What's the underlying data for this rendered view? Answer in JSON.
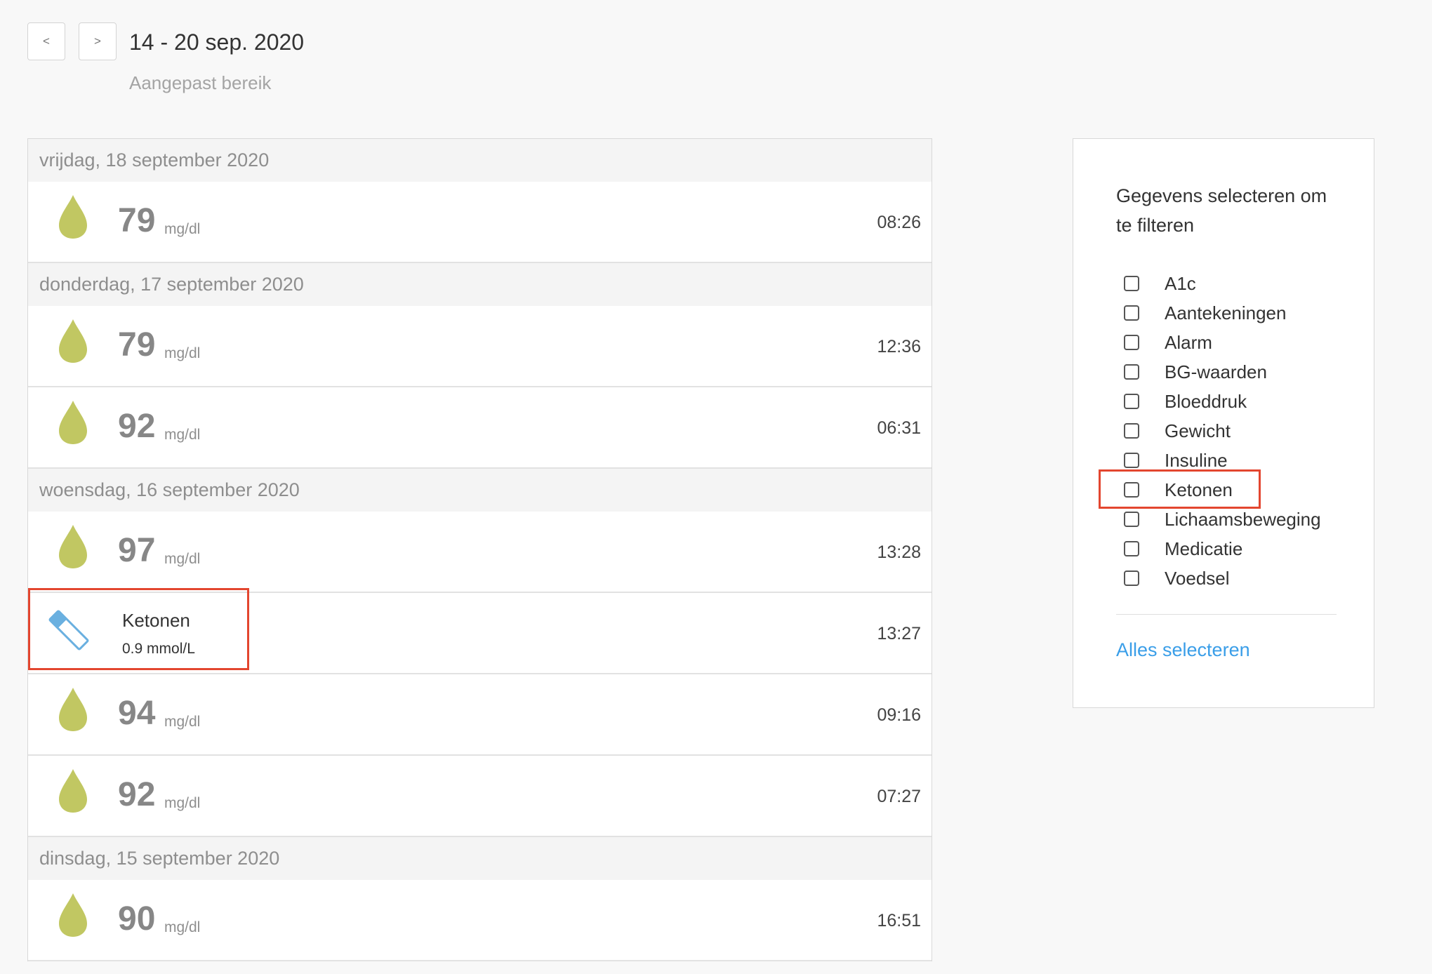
{
  "header": {
    "prev_label": "<",
    "next_label": ">",
    "date_range": "14 - 20 sep. 2020",
    "range_type": "Aangepast bereik"
  },
  "colors": {
    "drop": "#c1c762",
    "ketone_blue": "#6ab0e0",
    "link": "#3a9ee8",
    "highlight": "#e3462f"
  },
  "days": [
    {
      "label": "vrijdag, 18 september 2020",
      "entries": [
        {
          "type": "bg",
          "icon": "blood-drop-icon",
          "value": "79",
          "unit": "mg/dl",
          "time": "08:26"
        }
      ]
    },
    {
      "label": "donderdag, 17 september 2020",
      "entries": [
        {
          "type": "bg",
          "icon": "blood-drop-icon",
          "value": "79",
          "unit": "mg/dl",
          "time": "12:36"
        },
        {
          "type": "bg",
          "icon": "blood-drop-icon",
          "value": "92",
          "unit": "mg/dl",
          "time": "06:31"
        }
      ]
    },
    {
      "label": "woensdag, 16 september 2020",
      "entries": [
        {
          "type": "bg",
          "icon": "blood-drop-icon",
          "value": "97",
          "unit": "mg/dl",
          "time": "13:28"
        },
        {
          "type": "ketone",
          "icon": "ketone-strip-icon",
          "name": "Ketonen",
          "value": "0.9 mmol/L",
          "time": "13:27"
        },
        {
          "type": "bg",
          "icon": "blood-drop-icon",
          "value": "94",
          "unit": "mg/dl",
          "time": "09:16"
        },
        {
          "type": "bg",
          "icon": "blood-drop-icon",
          "value": "92",
          "unit": "mg/dl",
          "time": "07:27"
        }
      ]
    },
    {
      "label": "dinsdag, 15 september 2020",
      "entries": [
        {
          "type": "bg",
          "icon": "blood-drop-icon",
          "value": "90",
          "unit": "mg/dl",
          "time": "16:51"
        }
      ]
    }
  ],
  "filter": {
    "title": "Gegevens selecteren om te filteren",
    "items": [
      {
        "label": "A1c",
        "checked": false
      },
      {
        "label": "Aantekeningen",
        "checked": false
      },
      {
        "label": "Alarm",
        "checked": false
      },
      {
        "label": "BG-waarden",
        "checked": false
      },
      {
        "label": "Bloeddruk",
        "checked": false
      },
      {
        "label": "Gewicht",
        "checked": false
      },
      {
        "label": "Insuline",
        "checked": false
      },
      {
        "label": "Ketonen",
        "checked": false
      },
      {
        "label": "Lichaamsbeweging",
        "checked": false
      },
      {
        "label": "Medicatie",
        "checked": false
      },
      {
        "label": "Voedsel",
        "checked": false
      }
    ],
    "select_all": "Alles selecteren"
  }
}
